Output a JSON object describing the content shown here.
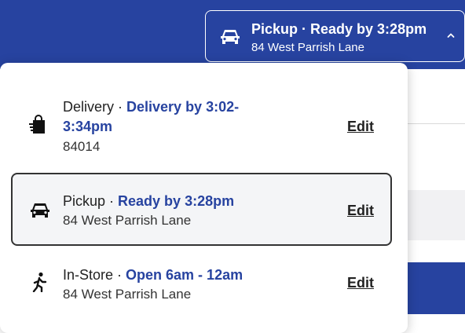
{
  "header": {
    "pickup_summary": {
      "title": "Pickup · Ready by 3:28pm",
      "address": "84 West Parrish Lane",
      "icon": "car-icon",
      "chevron": "chevron-up-icon"
    }
  },
  "fulfillment_options": [
    {
      "icon": "shopping-bag-icon",
      "title": "Delivery",
      "separator": " · ",
      "status_line1": "Delivery by 3:02-",
      "status_line2": "3:34pm",
      "sub": "84014",
      "edit_label": "Edit",
      "selected": false
    },
    {
      "icon": "car-icon",
      "title": "Pickup",
      "separator": " · ",
      "status": "Ready by 3:28pm",
      "sub": "84 West Parrish Lane",
      "edit_label": "Edit",
      "selected": true
    },
    {
      "icon": "walking-person-icon",
      "title": "In-Store",
      "separator": " · ",
      "status": "Open 6am - 12am",
      "sub": "84 West Parrish Lane",
      "edit_label": "Edit",
      "selected": false
    }
  ],
  "colors": {
    "brand_blue": "#2743a0",
    "selected_bg": "#f4f5f7",
    "selected_border": "#333333"
  }
}
